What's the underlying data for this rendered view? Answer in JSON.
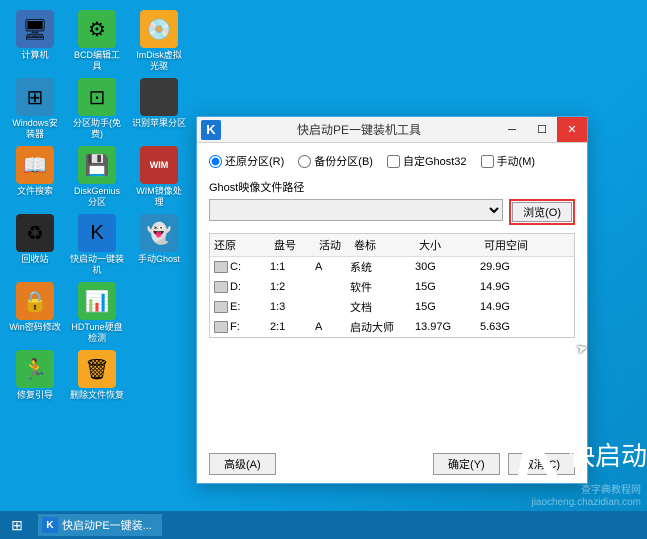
{
  "desktop_icons": [
    {
      "label": "计算机",
      "bg": "#3a6fb8",
      "glyph": "🖥"
    },
    {
      "label": "Windows安装器",
      "bg": "#2a8ac2",
      "glyph": "⊞"
    },
    {
      "label": "文件搜索",
      "bg": "#e57c1f",
      "glyph": "📖"
    },
    {
      "label": "回收站",
      "bg": "#2a2a2a",
      "glyph": "♻"
    },
    {
      "label": "Win密码修改",
      "bg": "#e57c1f",
      "glyph": "🔒"
    },
    {
      "label": "修复引导",
      "bg": "#3ab54a",
      "glyph": "🏃"
    },
    {
      "label": "BCD编辑工具",
      "bg": "#3ab54a",
      "glyph": "⚙"
    },
    {
      "label": "分区助手(免费)",
      "bg": "#3ab54a",
      "glyph": "⊡"
    },
    {
      "label": "DiskGenius分区",
      "bg": "#3ab54a",
      "glyph": "💾"
    },
    {
      "label": "快启动一键装机",
      "bg": "#1976d2",
      "glyph": "K"
    },
    {
      "label": "HDTune硬盘检测",
      "bg": "#3ab54a",
      "glyph": "📊"
    },
    {
      "label": "删除文件恢复",
      "bg": "#f5a623",
      "glyph": "🗑"
    },
    {
      "label": "ImDisk虚拟光驱",
      "bg": "#f5a623",
      "glyph": "💿"
    },
    {
      "label": "识别苹果分区",
      "bg": "#3a3a3a",
      "glyph": ""
    },
    {
      "label": "WIM镜像处理",
      "bg": "#b8352f",
      "glyph": "WIM"
    },
    {
      "label": "手动Ghost",
      "bg": "#2a8ac2",
      "glyph": "👻"
    }
  ],
  "window": {
    "title": "快启动PE一键装机工具",
    "radios": {
      "restore": "还原分区(R)",
      "backup": "备份分区(B)",
      "ghost32": "自定Ghost32",
      "manual": "手动(M)"
    },
    "path_label": "Ghost映像文件路径",
    "browse": "浏览(O)",
    "headers": {
      "drive": "还原",
      "slot": "盘号",
      "active": "活动",
      "volume": "卷标",
      "size": "大小",
      "free": "可用空间"
    },
    "rows": [
      {
        "drive": "C:",
        "slot": "1:1",
        "active": "A",
        "volume": "系统",
        "size": "30G",
        "free": "29.9G"
      },
      {
        "drive": "D:",
        "slot": "1:2",
        "active": "",
        "volume": "软件",
        "size": "15G",
        "free": "14.9G"
      },
      {
        "drive": "E:",
        "slot": "1:3",
        "active": "",
        "volume": "文档",
        "size": "15G",
        "free": "14.9G"
      },
      {
        "drive": "F:",
        "slot": "2:1",
        "active": "A",
        "volume": "启动大师",
        "size": "13.97G",
        "free": "5.63G"
      }
    ],
    "buttons": {
      "advanced": "高级(A)",
      "ok": "确定(Y)",
      "cancel": "取消(C)"
    }
  },
  "brand": {
    "k": "K",
    "text": "快启动"
  },
  "watermark": {
    "line1": "查字典教程网",
    "line2": "jiaocheng.chazidian.com"
  },
  "taskbar": {
    "item": "快启动PE一键装..."
  }
}
